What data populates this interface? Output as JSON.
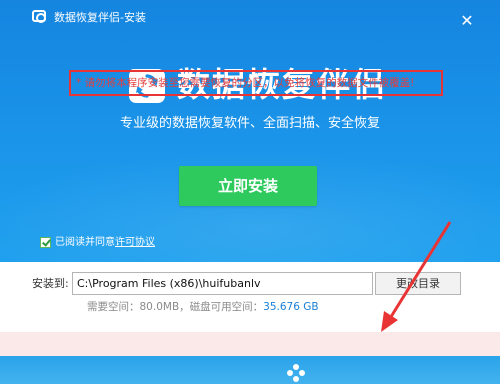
{
  "window": {
    "title": "数据恢复伴侣-安装",
    "close_glyph": "✕",
    "app_icon": "camera-restore-icon"
  },
  "hero": {
    "logo_icon": "recycle-restore-icon",
    "product_name": "数据恢复伴侣",
    "slogan": "专业级的数据恢复软件、全面扫描、安全恢复",
    "install_button": "立即安装"
  },
  "agreement": {
    "checked": true,
    "text": "已阅读并同意",
    "link": "许可协议"
  },
  "install_path": {
    "label": "安装到:",
    "value": "C:\\Program Files (x86)\\huifubanlv",
    "browse_button": "更改目录",
    "required_label": "需要空间：",
    "required_value": "80.0MB",
    "available_label": "，磁盘可用空间：",
    "available_value": "35.676 GB"
  },
  "warning": {
    "text": "* 请勿将本程序安装至您需要恢复的分区，以免将恢复的数据文件被覆盖!"
  },
  "colors": {
    "header_blue": "#1b96ea",
    "install_green": "#2fca5e",
    "warning_red": "#e23d3d",
    "accent_blue": "#1a7fd4"
  }
}
